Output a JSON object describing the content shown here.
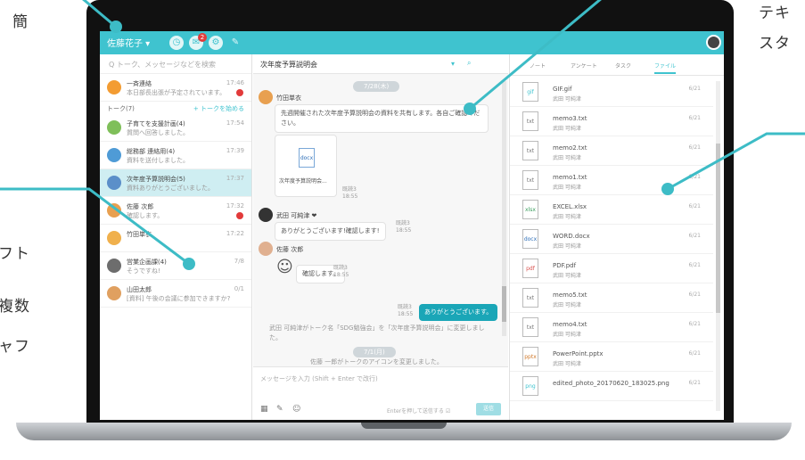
{
  "side_text": {
    "left_top": "簡",
    "left_lines": [
      "フト",
      "複数",
      "ャフ"
    ],
    "right_lines": [
      "テキ",
      "スタ"
    ]
  },
  "topbar": {
    "user": "佐藤花子 ▾",
    "badge": "2"
  },
  "left": {
    "search_placeholder": "Q トーク、メッセージなどを検索",
    "pinned": {
      "title": "一斉連絡",
      "sub": "本日部長出張が予定されています。",
      "time": "17:46"
    },
    "group_label": "トーク(7)",
    "group_action": "+ トークを始める",
    "items": [
      {
        "title": "子育てを支援計画(4)",
        "sub": "質問へ回答しました。",
        "time": "17:54"
      },
      {
        "title": "総務部 連絡用(4)",
        "sub": "資料を送付しました。",
        "time": "17:39"
      },
      {
        "title": "次年度予算説明会(5)",
        "sub": "資料ありがとうございました。",
        "time": "17:37"
      },
      {
        "title": "佐藤 次郎",
        "sub": "確認します。",
        "time": "17:32"
      },
      {
        "title": "竹田単衣",
        "sub": "",
        "time": "17:22"
      },
      {
        "title": "営業企画課(4)",
        "sub": "そうですね!",
        "time": "7/8"
      },
      {
        "title": "山田太郎",
        "sub": "[資料] 午後の会議に参加できますか?",
        "time": "0/1"
      }
    ]
  },
  "middle": {
    "title": "次年度予算説明会",
    "date1": "7/28(木)",
    "sender1": "竹田単衣",
    "msg1": "先週開催された次年度予算説明会の資料を共有します。各自ご確認ください。",
    "attach_name": "次年度予算説明会...",
    "attach_ext": "docx",
    "read1": "既読3",
    "time1": "18:55",
    "sender2": "武田 可純津 ❤",
    "msg2": "ありがとうございます!確認します!",
    "read2": "既読3",
    "time2": "18:55",
    "sender3": "佐藤 次郎",
    "msg3": "確認します。",
    "read3": "既読3",
    "time3": "18:55",
    "mine_msg": "ありがとうございます。",
    "mine_read": "既読3",
    "mine_time": "18:55",
    "sys1": "武田 可純津がトーク名「SDG勉強会」を「次年度予算説明会」に変更しました。",
    "date2": "7/1(月)",
    "sys2": "佐藤 一郎がトークのアイコンを変更しました。",
    "input_placeholder": "メッセージを入力 (Shift + Enter で改行)",
    "send_hint": "Enterを押して送信する ☑",
    "send_label": "送信"
  },
  "right": {
    "tabs": [
      "ノート",
      "アンケート",
      "タスク",
      "ファイル"
    ],
    "files": [
      {
        "ext": "gif",
        "name": "GIF.gif",
        "by": "武田 可純津",
        "date": "6/21"
      },
      {
        "ext": "txt",
        "name": "memo3.txt",
        "by": "武田 可純津",
        "date": "6/21"
      },
      {
        "ext": "txt",
        "name": "memo2.txt",
        "by": "武田 可純津",
        "date": "6/21"
      },
      {
        "ext": "txt",
        "name": "memo1.txt",
        "by": "武田 可純津",
        "date": "6/21"
      },
      {
        "ext": "xlsx",
        "name": "EXCEL.xlsx",
        "by": "武田 可純津",
        "date": "6/21"
      },
      {
        "ext": "docx",
        "name": "WORD.docx",
        "by": "武田 可純津",
        "date": "6/21"
      },
      {
        "ext": "pdf",
        "name": "PDF.pdf",
        "by": "武田 可純津",
        "date": "6/21"
      },
      {
        "ext": "txt",
        "name": "memo5.txt",
        "by": "武田 可純津",
        "date": "6/21"
      },
      {
        "ext": "txt",
        "name": "memo4.txt",
        "by": "武田 可純津",
        "date": "6/21"
      },
      {
        "ext": "pptx",
        "name": "PowerPoint.pptx",
        "by": "武田 可純津",
        "date": "6/21"
      },
      {
        "ext": "png",
        "name": "edited_photo_20170620_183025.png",
        "by": "",
        "date": "6/21"
      }
    ]
  },
  "colors": {
    "accent": "#3fc3cf",
    "callout": "#3dbcc6",
    "alert": "#e23a3a"
  }
}
